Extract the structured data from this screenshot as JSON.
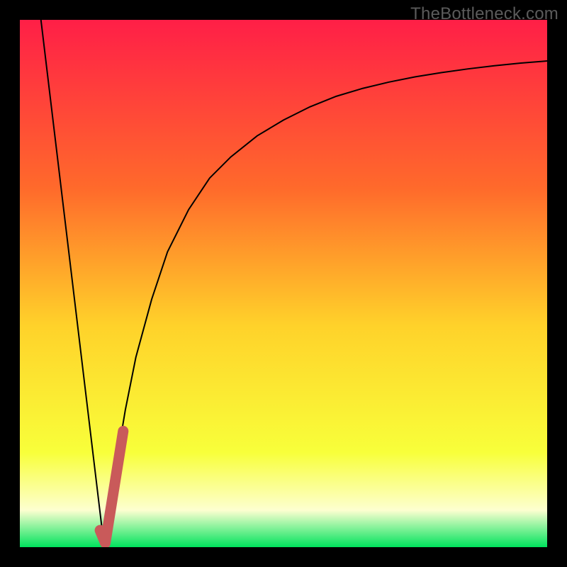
{
  "watermark": "TheBottleneck.com",
  "colors": {
    "gradient_top": "#ff1f47",
    "gradient_upper_mid": "#ff6a2b",
    "gradient_mid": "#ffd22a",
    "gradient_lower_mid": "#f8ff3a",
    "gradient_pale": "#fdffd0",
    "gradient_bottom": "#00e35d",
    "curve": "#000000",
    "marker": "#c95a5a",
    "frame": "#000000"
  },
  "chart_data": {
    "type": "line",
    "title": "",
    "xlabel": "",
    "ylabel": "",
    "xlim": [
      0,
      100
    ],
    "ylim": [
      0,
      100
    ],
    "series": [
      {
        "name": "left-descent",
        "x": [
          4,
          16
        ],
        "values": [
          100,
          0
        ]
      },
      {
        "name": "right-curve",
        "x": [
          16,
          18,
          20,
          22,
          25,
          28,
          32,
          36,
          40,
          45,
          50,
          55,
          60,
          65,
          70,
          75,
          80,
          85,
          90,
          95,
          100
        ],
        "values": [
          0,
          14,
          26,
          36,
          47,
          56,
          64,
          70,
          74,
          78,
          81,
          83.5,
          85.5,
          87,
          88.2,
          89.2,
          90,
          90.7,
          91.3,
          91.8,
          92.2
        ]
      }
    ],
    "marker": {
      "name": "optimal-indicator",
      "points": [
        {
          "x": 15.2,
          "y": 3.2
        },
        {
          "x": 16.2,
          "y": 0.8
        },
        {
          "x": 19.6,
          "y": 22
        }
      ]
    }
  }
}
